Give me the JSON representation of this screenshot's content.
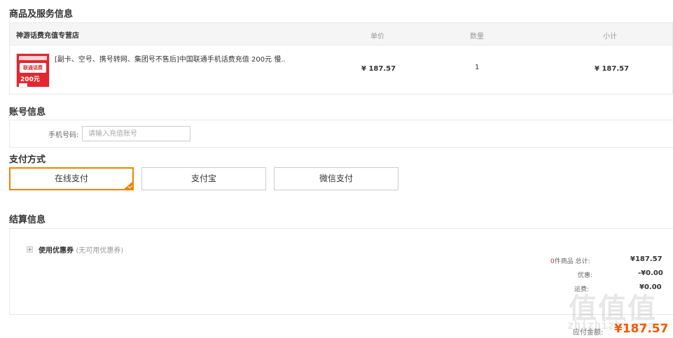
{
  "sections": {
    "product": "商品及服务信息",
    "account": "账号信息",
    "payment": "支付方式",
    "settlement": "结算信息"
  },
  "product_table": {
    "shop_name": "神游话费充值专营店",
    "columns": [
      "单价",
      "数量",
      "小计"
    ],
    "item": {
      "name": "[副卡、空号、携号转网、集团号不售后]中国联通手机话费充值 200元 慢...",
      "thumb_text": "联通话费",
      "thumb_amount": "200元",
      "unit_price": "¥ 187.57",
      "quantity": "1",
      "subtotal": "¥ 187.57"
    }
  },
  "account": {
    "label": "手机号码:",
    "placeholder": "请输入充值账号",
    "value": ""
  },
  "payment_methods": [
    {
      "label": "在线支付",
      "selected": true
    },
    {
      "label": "支付宝",
      "selected": false
    },
    {
      "label": "微信支付",
      "selected": false
    }
  ],
  "settlement": {
    "coupon_label": "使用优惠券",
    "coupon_note": "(无可用优惠券)",
    "count_num": "0",
    "count_label": "件商品  总计:",
    "total": "¥187.57",
    "discount_label": "优惠:",
    "discount": "-¥0.00",
    "shipping_label": "运费:",
    "shipping": "¥0.00",
    "pay_label": "应付金额:",
    "pay_total": "¥187.57"
  },
  "watermark": {
    "logo": "值值值",
    "site": "zhizhizhi.com"
  },
  "colors": {
    "accent": "#f08200",
    "total": "#f05a00",
    "red": "#e4262f",
    "border": "#e8e8e8"
  }
}
